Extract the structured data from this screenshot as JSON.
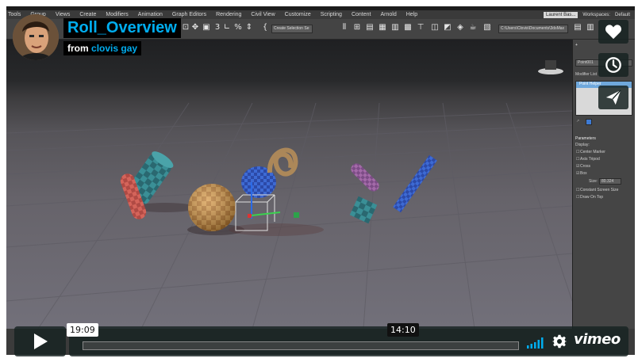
{
  "video": {
    "title": "Roll_Overview",
    "byline_prefix": "from",
    "author": "clovis gay",
    "elapsed_time": "19:09",
    "hover_time": "14:10",
    "played_fraction": 0.0
  },
  "side_actions": [
    {
      "name": "like-button",
      "icon": "heart-icon"
    },
    {
      "name": "watch-later-button",
      "icon": "clock-icon"
    },
    {
      "name": "share-button",
      "icon": "paper-plane-icon"
    }
  ],
  "brand": {
    "logo_text": "vimeo",
    "accent": "#00adef"
  },
  "app": {
    "menu": [
      "Tools",
      "Group",
      "Views",
      "Create",
      "Modifiers",
      "Animation",
      "Graph Editors",
      "Rendering",
      "Civil View",
      "Customize",
      "Scripting",
      "Content",
      "Arnold",
      "Help"
    ],
    "user": "Laurent Bas...",
    "workspace_label": "Workspaces:",
    "workspace_value": "Default",
    "selection_set": "Create Selection Se",
    "path_field": "C:\\Users\\Clovis\\Documents\\3dsMax",
    "panel": {
      "object_name": "Point001",
      "modifier_list": "Modifier List",
      "stack_item": "Point Helper",
      "rollout": "Parameters",
      "display_label": "Display:",
      "options": [
        {
          "label": "Center Marker",
          "checked": false
        },
        {
          "label": "Axis Tripod",
          "checked": false
        },
        {
          "label": "Cross",
          "checked": true
        },
        {
          "label": "Box",
          "checked": true
        }
      ],
      "size_label": "Size:",
      "size_value": "80.324",
      "extra_options": [
        {
          "label": "Constant Screen Size",
          "checked": false
        },
        {
          "label": "Draw On Top",
          "checked": false
        }
      ]
    }
  }
}
